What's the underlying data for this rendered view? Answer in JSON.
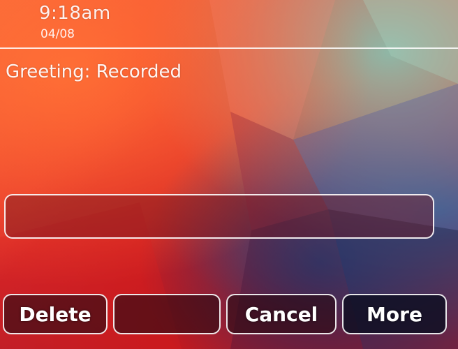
{
  "status": {
    "time": "9:18am",
    "date": "04/08"
  },
  "message": {
    "greeting": "Greeting: Recorded"
  },
  "input": {
    "value": ""
  },
  "softkeys": [
    {
      "label": "Delete"
    },
    {
      "label": ""
    },
    {
      "label": "Cancel"
    },
    {
      "label": "More"
    }
  ],
  "colors": {
    "text": "#ffffff",
    "outline": "#ffffff",
    "background_primary": "#e8342a"
  }
}
